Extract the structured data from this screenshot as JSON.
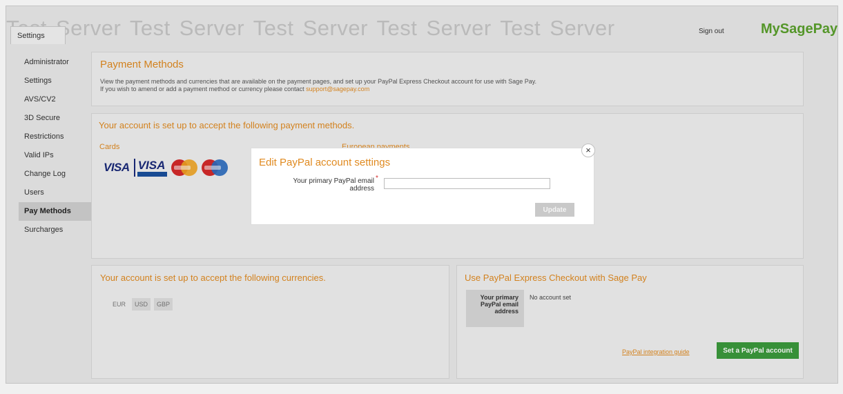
{
  "header": {
    "watermark": "Test Server  Test Server  Test Server  Test Server  Test Server",
    "settings_tab": "Settings",
    "sign_out": "Sign out",
    "brand": "MySagePay"
  },
  "sidebar": {
    "items": [
      {
        "label": "Administrator"
      },
      {
        "label": "Settings"
      },
      {
        "label": "AVS/CV2"
      },
      {
        "label": "3D Secure"
      },
      {
        "label": "Restrictions"
      },
      {
        "label": "Valid IPs"
      },
      {
        "label": "Change Log"
      },
      {
        "label": "Users"
      },
      {
        "label": "Pay Methods"
      },
      {
        "label": "Surcharges"
      }
    ],
    "active_item": "Pay Methods"
  },
  "payment_methods": {
    "title": "Payment Methods",
    "line1": "View the payment methods and currencies that are available on the payment pages, and set up your PayPal Express Checkout account for use with Sage Pay.",
    "line2": "If you wish to amend or add a payment method or currency please contact ",
    "contact_email": "support@sagepay.com"
  },
  "accepted_methods": {
    "title": "Your account is set up to accept the following payment methods.",
    "cards_label": "Cards",
    "european_label": "European payments",
    "card_icons": [
      "visa-icon",
      "visa-debit-icon",
      "mastercard-icon",
      "maestro-icon"
    ],
    "visa_text": "VISA"
  },
  "currencies": {
    "title": "Your account is set up to accept the following currencies.",
    "items": [
      "EUR",
      "USD",
      "GBP"
    ]
  },
  "paypal": {
    "title": "Use PayPal Express Checkout with Sage Pay",
    "account_label": "Your primary PayPal email address",
    "account_value": "No account set",
    "guide_link": "PayPal integration guide",
    "set_button": "Set a PayPal account"
  },
  "modal": {
    "title": "Edit PayPal account settings",
    "field_label": "Your primary PayPal email address",
    "required_marker": "*",
    "email_value": "",
    "update_button": "Update",
    "close_symbol": "×"
  },
  "colors": {
    "accent": "#e08a20",
    "brand": "#5aa02c",
    "button_green": "#3b9a3c"
  }
}
